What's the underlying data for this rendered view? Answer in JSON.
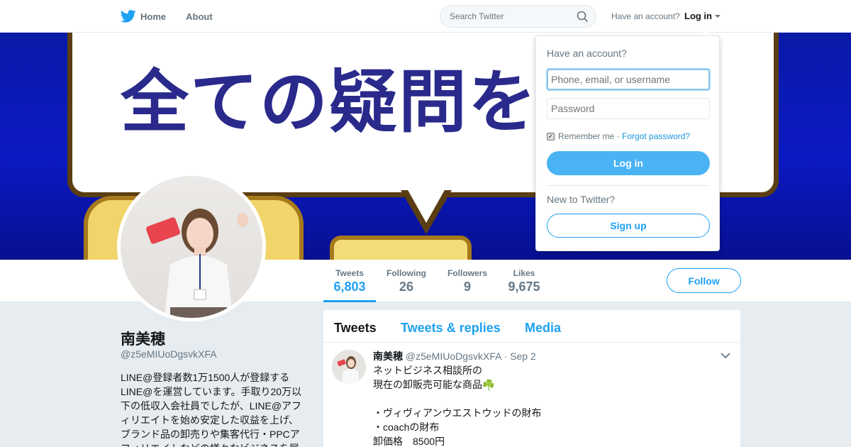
{
  "nav": {
    "home_label": "Home",
    "about_label": "About",
    "search_placeholder": "Search Twitter",
    "have_account": "Have an account?",
    "login_label": "Log in"
  },
  "banner": {
    "text": "全ての疑問を"
  },
  "profile": {
    "name": "南美穂",
    "handle": "@z5eMIUoDgsvkXFA",
    "bio": "LINE@登録者数1万1500人が登録するLINE@を運営しています。手取り20万以下の低収入会社員でしたが、LINE@アフィリエイトを始め安定した収益を上げ、ブランド品の卸売りや集客代行・PPCアフィリエイトなどの様々なビジネスを展"
  },
  "stats": [
    {
      "label": "Tweets",
      "value": "6,803"
    },
    {
      "label": "Following",
      "value": "26"
    },
    {
      "label": "Followers",
      "value": "9"
    },
    {
      "label": "Likes",
      "value": "9,675"
    }
  ],
  "follow_label": "Follow",
  "tabs": [
    "Tweets",
    "Tweets & replies",
    "Media"
  ],
  "tweet": {
    "name": "南美穂",
    "handle": "@z5eMIUoDgsvkXFA",
    "date": "· Sep 2",
    "text": "ネットビジネス相談所の\n現在の卸販売可能な商品☘️\n\n・ヴィヴィアンウエストウッドの財布\n・coachの財布\n卸価格　8500円"
  },
  "login_dropdown": {
    "title": "Have an account?",
    "username_placeholder": "Phone, email, or username",
    "password_placeholder": "Password",
    "remember_label": "Remember me",
    "forgot_label": "Forgot password?",
    "login_button": "Log in",
    "new_label": "New to Twitter?",
    "signup_button": "Sign up"
  },
  "colors": {
    "accent": "#1da1f2",
    "login_button": "#4ab3f4",
    "banner_blue": "#0b19c2"
  }
}
